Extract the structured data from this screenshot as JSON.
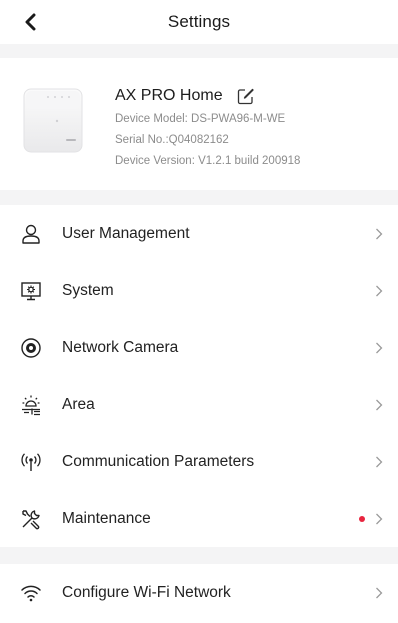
{
  "header": {
    "title": "Settings",
    "back_icon": "back-chevron-icon"
  },
  "device": {
    "name": "AX PRO Home",
    "model": "Device Model: DS-PWA96-M-WE",
    "serial": "Serial No.:Q04082162",
    "version": "Device Version: V1.2.1 build 200918",
    "edit_icon": "edit-icon"
  },
  "menu": {
    "items": [
      {
        "label": "User Management",
        "icon": "user-icon"
      },
      {
        "label": "System",
        "icon": "system-icon"
      },
      {
        "label": "Network Camera",
        "icon": "camera-icon"
      },
      {
        "label": "Area",
        "icon": "area-icon"
      },
      {
        "label": "Communication Parameters",
        "icon": "antenna-icon"
      },
      {
        "label": "Maintenance",
        "icon": "tools-icon",
        "badge": "red-dot"
      }
    ]
  },
  "wifi": {
    "label": "Configure Wi-Fi Network",
    "icon": "wifi-icon"
  },
  "colors": {
    "badge": "#e8253f",
    "separator": "#f4f4f5",
    "secondary_text": "#8c8c8c"
  }
}
